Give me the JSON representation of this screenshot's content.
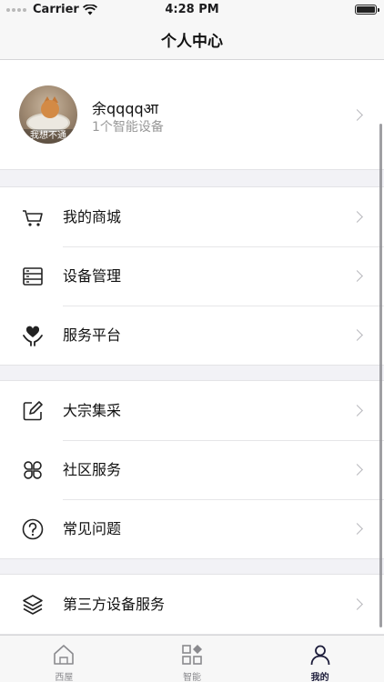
{
  "status_bar": {
    "carrier": "Carrier",
    "time": "4:28 PM"
  },
  "nav": {
    "title": "个人中心"
  },
  "profile": {
    "name": "余qqqqआ",
    "subtitle": "1个智能设备",
    "avatar_caption": "我想不通"
  },
  "groups": [
    {
      "items": [
        {
          "label": "我的商城",
          "icon": "cart-icon"
        },
        {
          "label": "设备管理",
          "icon": "device-list-icon"
        },
        {
          "label": "服务平台",
          "icon": "heart-hand-icon"
        }
      ]
    },
    {
      "items": [
        {
          "label": "大宗集采",
          "icon": "edit-icon"
        },
        {
          "label": "社区服务",
          "icon": "grid-clover-icon"
        },
        {
          "label": "常见问题",
          "icon": "question-icon"
        }
      ]
    },
    {
      "items": [
        {
          "label": "第三方设备服务",
          "icon": "layers-icon"
        }
      ]
    }
  ],
  "tabs": [
    {
      "label": "西屋",
      "icon": "home-icon",
      "active": false
    },
    {
      "label": "智能",
      "icon": "smart-grid-icon",
      "active": false
    },
    {
      "label": "我的",
      "icon": "person-icon",
      "active": true
    }
  ],
  "colors": {
    "accent": "#1c1c3a",
    "separator": "#e3e3e6",
    "background": "#f2f2f6"
  }
}
